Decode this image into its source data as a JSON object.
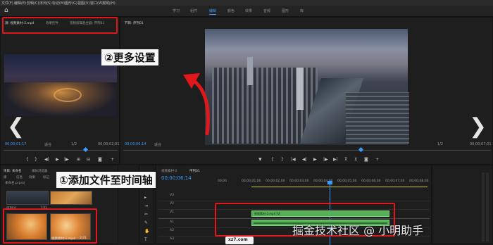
{
  "menu": [
    "文件(F)",
    "编辑(E)",
    "剪辑(C)",
    "序列(S)",
    "标记(M)",
    "图形(G)",
    "视图(V)",
    "窗口(W)",
    "帮助(H)"
  ],
  "workspaces": [
    "学习",
    "组件",
    "编辑",
    "颜色",
    "效果",
    "音频",
    "图形",
    "库"
  ],
  "source": {
    "tab_active": "源: 视频素材-2.mp4",
    "tab2": "效果控件",
    "tab3": "音频剪辑混合器: 序列01",
    "timecode_left": "00;00;01;17",
    "timecode_right": "00;00;02;01",
    "fit": "适合",
    "scale": "1/2"
  },
  "program": {
    "title": "节目: 序列01",
    "timecode_left": "00;00;06;14",
    "fit": "适合",
    "scale": "1/2",
    "timecode_right": "00;00;07;01"
  },
  "project": {
    "tab1": "项目: 未命名",
    "tab2": "媒体浏览器",
    "tab3": "库",
    "tab4": "信息",
    "tab5": "效果",
    "tab6": "标记",
    "search_placeholder": "未命名.prproj",
    "items": [
      {
        "name": "序列01",
        "meta": "7;01"
      },
      {
        "name": "视频素材-2.mp4",
        "meta": "2;01"
      }
    ]
  },
  "timeline": {
    "tab1": "视频素材-2",
    "tab2": "序列01",
    "timecode": "00;00;06;14",
    "ruler": [
      "00;00",
      "00;00;01;00",
      "00;00;02;00",
      "00;00;03;00",
      "00;00;04;00",
      "00;00;05;00",
      "00;00;06;00",
      "00;00;07;00",
      "00;00;08;00"
    ],
    "tracks": [
      "V3",
      "V2",
      "V1",
      "A1",
      "A2",
      "A3"
    ],
    "clip_v1_label": "视频素材-2.mp4 [V]"
  },
  "annotations": {
    "more_settings": "②更多设置",
    "add_to_timeline": "①添加文件至时间轴"
  },
  "watermark": {
    "text": "掘金技术社区 @ 小明助手",
    "site": "xz7.com"
  },
  "colors": {
    "accent": "#3b9bff",
    "annotation_red": "#e0181c",
    "clip_green": "#56b058"
  }
}
